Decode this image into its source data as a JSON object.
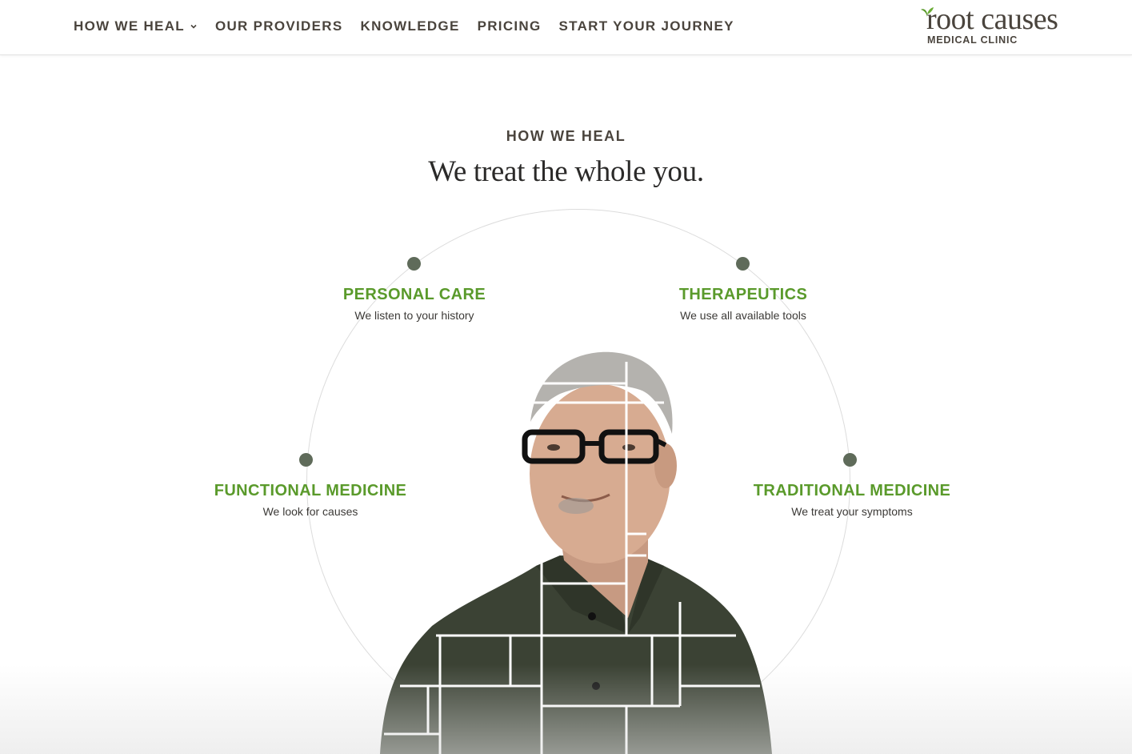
{
  "nav": {
    "items": [
      {
        "label": "HOW WE HEAL",
        "has_dropdown": true,
        "icon": "chevron-down-icon"
      },
      {
        "label": "OUR PROVIDERS"
      },
      {
        "label": "KNOWLEDGE"
      },
      {
        "label": "PRICING"
      },
      {
        "label": "START YOUR JOURNEY"
      }
    ]
  },
  "logo": {
    "name": "root causes",
    "subtitle": "MEDICAL CLINIC",
    "icon": "leaf-icon"
  },
  "hero": {
    "eyebrow": "HOW WE HEAL",
    "headline": "We treat the whole you.",
    "pillars": [
      {
        "title": "PERSONAL CARE",
        "desc": "We listen to your history"
      },
      {
        "title": "THERAPEUTICS",
        "desc": "We use all available tools"
      },
      {
        "title": "FUNCTIONAL MEDICINE",
        "desc": "We look for causes"
      },
      {
        "title": "TRADITIONAL MEDICINE",
        "desc": "We treat your symptoms"
      }
    ]
  },
  "colors": {
    "accent_green": "#5a9a2b",
    "nav_text": "#4a443d",
    "dot": "#5f6b5a",
    "shirt": "#3b4234"
  }
}
